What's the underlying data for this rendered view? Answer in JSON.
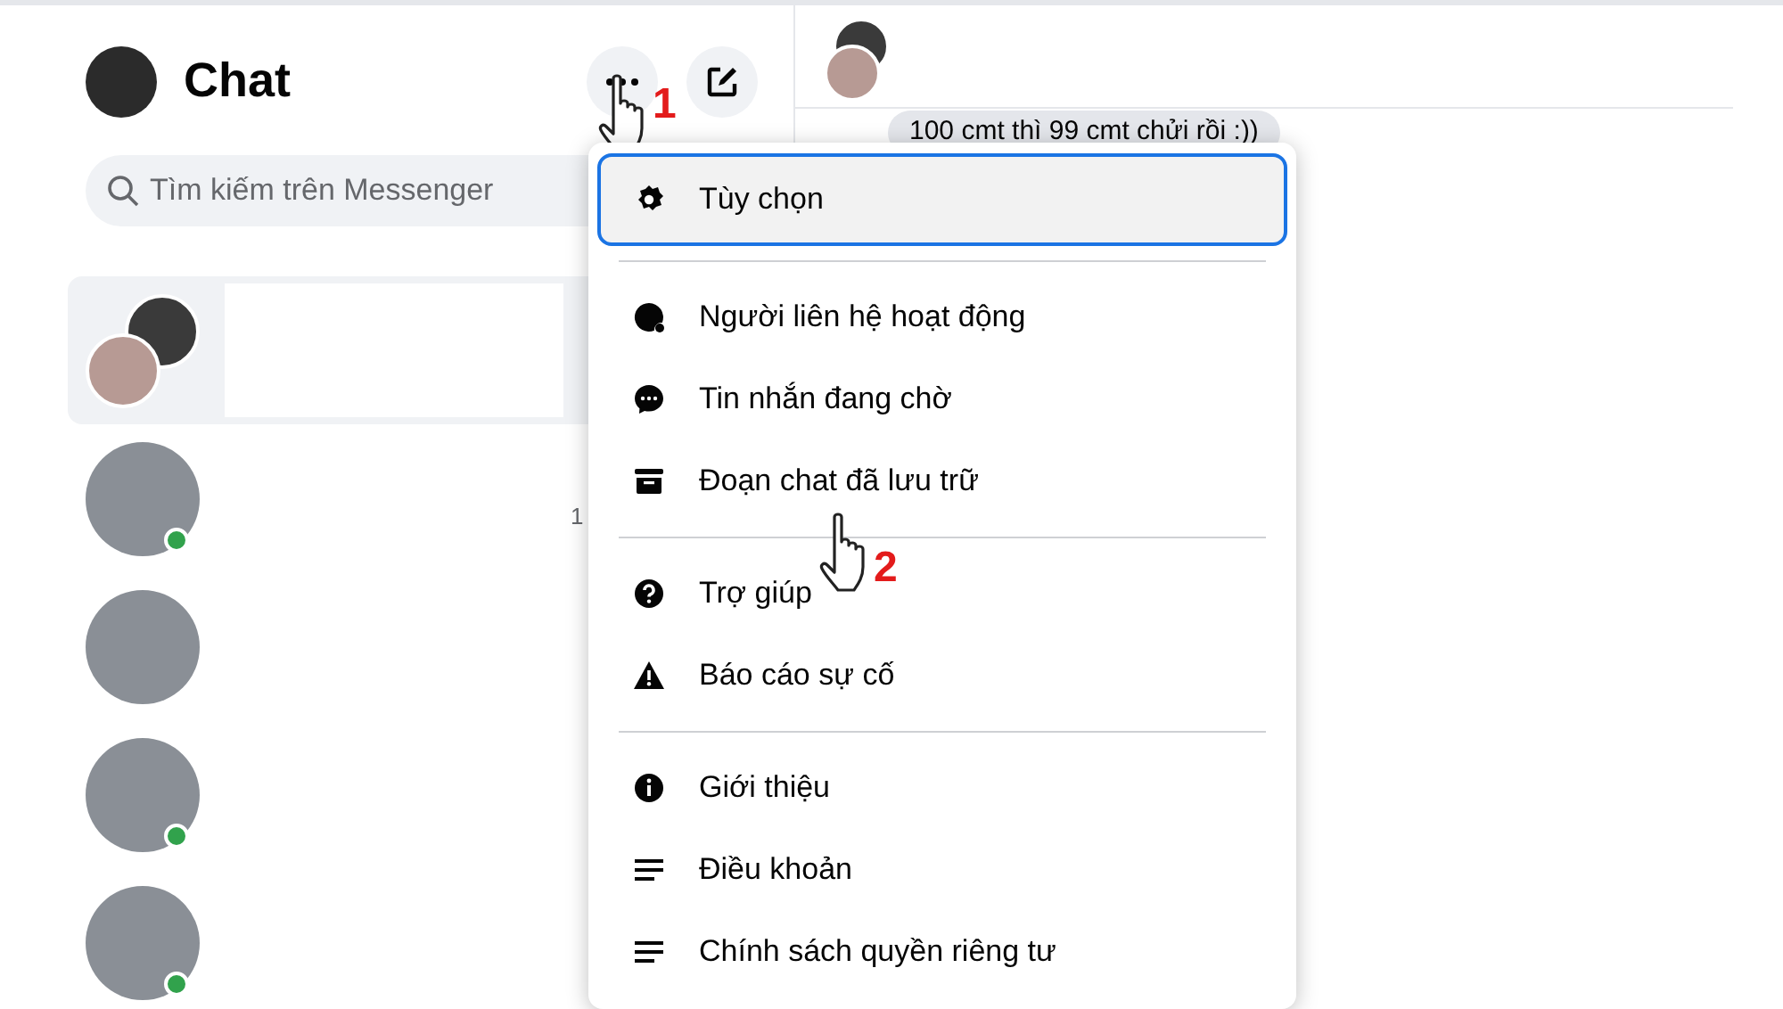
{
  "header": {
    "title": "Chat",
    "more_button": {
      "pointer_label": "1"
    }
  },
  "search": {
    "placeholder": "Tìm kiếm trên Messenger"
  },
  "conversations": [
    {
      "kind": "group",
      "selected": true,
      "online": false
    },
    {
      "kind": "single",
      "selected": false,
      "online": true,
      "fragment": "1"
    },
    {
      "kind": "single",
      "selected": false,
      "online": false
    },
    {
      "kind": "single",
      "selected": false,
      "online": true
    },
    {
      "kind": "single",
      "selected": false,
      "online": true
    }
  ],
  "conversation": {
    "message": "100 cmt thì 99 cmt chửi rồi :))"
  },
  "menu": {
    "sections": [
      [
        {
          "kind": "gear",
          "label": "Tùy chọn",
          "selected": true
        }
      ],
      [
        {
          "kind": "contacts",
          "label": "Người liên hệ hoạt động",
          "selected": false
        },
        {
          "kind": "bubble",
          "label": "Tin nhắn đang chờ",
          "selected": false
        },
        {
          "kind": "archive",
          "label": "Đoạn chat đã lưu trữ",
          "selected": false,
          "pointer_label": "2"
        }
      ],
      [
        {
          "kind": "help",
          "label": "Trợ giúp",
          "selected": false
        },
        {
          "kind": "warning",
          "label": "Báo cáo sự cố",
          "selected": false
        }
      ],
      [
        {
          "kind": "info",
          "label": "Giới thiệu",
          "selected": false
        },
        {
          "kind": "lines",
          "label": "Điều khoản",
          "selected": false
        },
        {
          "kind": "lines",
          "label": "Chính sách quyền riêng tư",
          "selected": false
        }
      ]
    ]
  }
}
